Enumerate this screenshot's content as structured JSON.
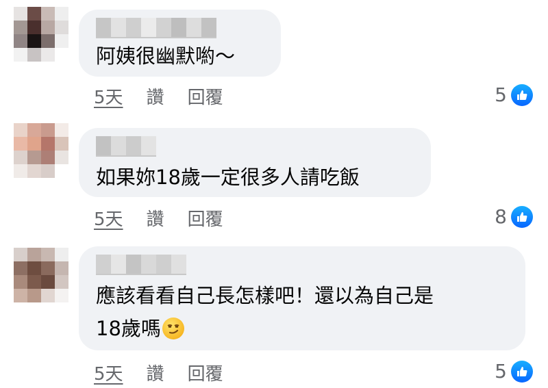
{
  "comments": [
    {
      "text_lines": [
        "阿姨很幽默喲～"
      ],
      "time": "5天",
      "like_label": "讚",
      "reply_label": "回覆",
      "reaction_count": "5",
      "reaction_icon": "like-thumb-icon"
    },
    {
      "text_lines": [
        "如果妳18歲一定很多人請吃飯"
      ],
      "time": "5天",
      "like_label": "讚",
      "reply_label": "回覆",
      "reaction_count": "8",
      "reaction_icon": "like-thumb-icon"
    },
    {
      "text_lines": [
        "應該看看自己長怎樣吧！還以為自己是",
        "18歲嗎"
      ],
      "emoji": "smirking-face-emoji",
      "time": "5天",
      "like_label": "讚",
      "reply_label": "回覆",
      "reaction_count": "5",
      "reaction_icon": "like-thumb-icon"
    }
  ],
  "colors": {
    "bubble": "#f0f2f5",
    "meta_text": "#65676b",
    "like_blue": "#0866ff"
  }
}
